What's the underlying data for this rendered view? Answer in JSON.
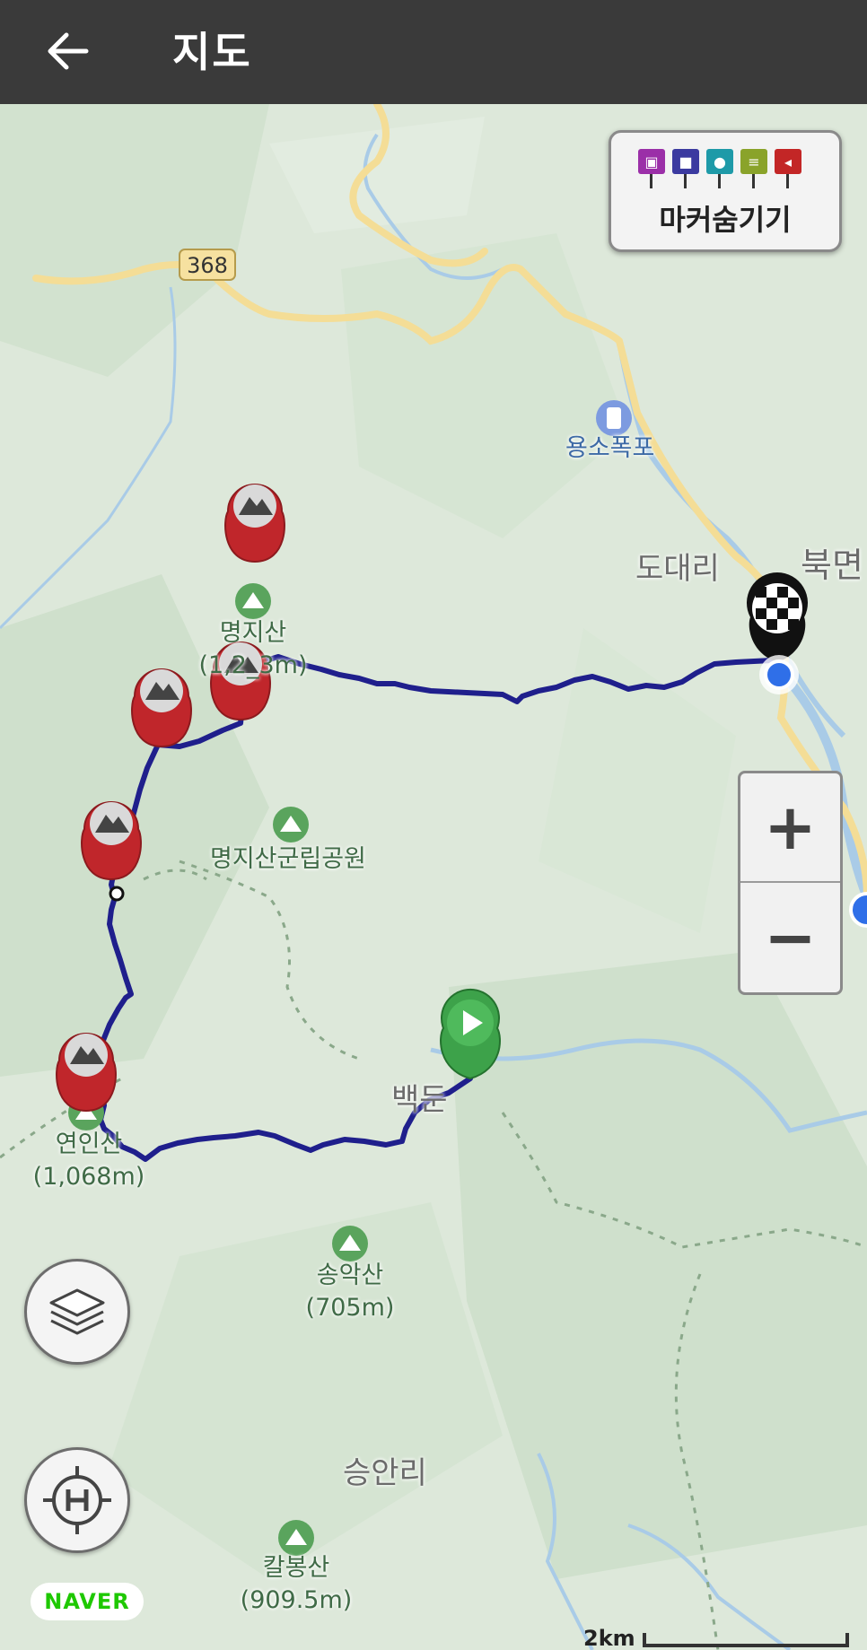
{
  "appbar": {
    "title": "지도",
    "back_icon": "arrow-left-icon"
  },
  "map": {
    "road_number": "368",
    "places": {
      "yongso_falls": "용소폭포",
      "dodae_ri": "도대리",
      "bukmyeon": "북면",
      "myeongji_peak_name": "명지산",
      "myeongji_peak_height": "(1,2_3m)",
      "myeongji_park": "명지산군립공원",
      "baekdun": "백둔",
      "yeonin_peak_name": "연인산",
      "yeonin_peak_height": "(1,068m)",
      "songak_peak_name": "송악산",
      "songak_peak_height": "(705m)",
      "seungan_ri": "승안리",
      "kalbong_peak_name": "칼봉산",
      "kalbong_peak_height": "(909.5m)"
    }
  },
  "marker_toggle": {
    "label": "마커숨기기",
    "icons": [
      {
        "name": "camera-icon",
        "color": "#9b2fa8",
        "glyph": "▣"
      },
      {
        "name": "video-icon",
        "color": "#3b3aa0",
        "glyph": "■"
      },
      {
        "name": "microphone-icon",
        "color": "#1e9aa8",
        "glyph": "●"
      },
      {
        "name": "note-icon",
        "color": "#8aa32a",
        "glyph": "≡"
      },
      {
        "name": "pin-icon",
        "color": "#c32626",
        "glyph": "◂"
      }
    ]
  },
  "zoom": {
    "in_label": "+",
    "out_label": "−"
  },
  "attribution": "NAVER",
  "scale_label": "2km",
  "colors": {
    "appbar": "#3a3a3a",
    "route": "#1f1f8c",
    "summit_marker": "#c0262b",
    "start_marker": "#3da24a",
    "current_location": "#2f6fe8"
  }
}
